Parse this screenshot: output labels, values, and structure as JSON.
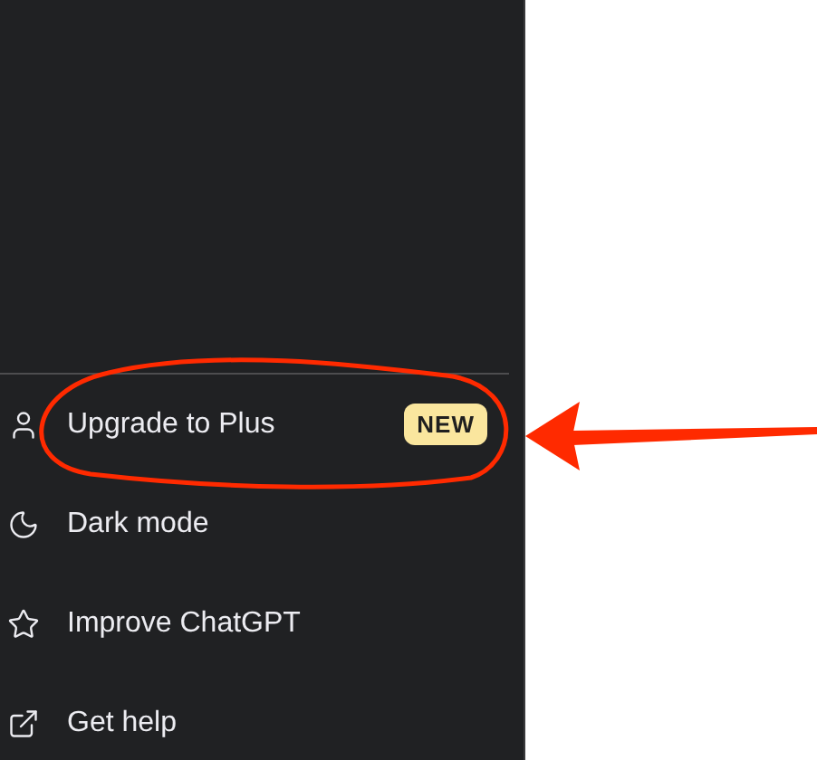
{
  "sidebar": {
    "items": [
      {
        "label": "Upgrade to Plus",
        "badge": "NEW"
      },
      {
        "label": "Dark mode"
      },
      {
        "label": "Improve ChatGPT"
      },
      {
        "label": "Get help"
      }
    ]
  },
  "annotation": {
    "kind": "circle-and-arrow"
  }
}
